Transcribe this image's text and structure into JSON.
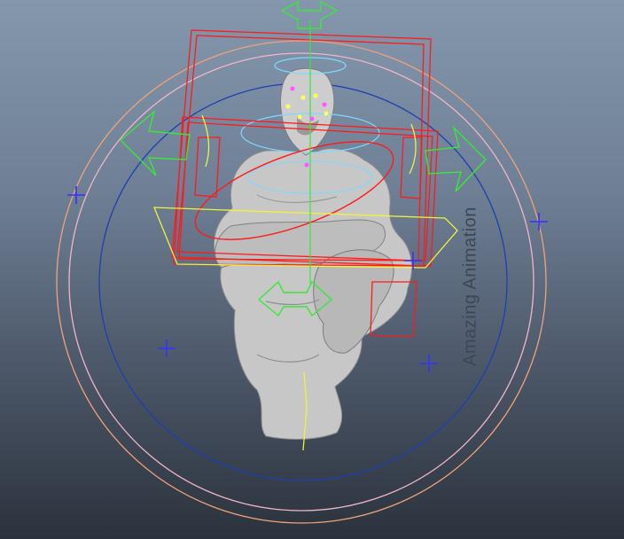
{
  "viewport": {
    "background_top": "#8497ad",
    "background_bottom": "#2b323c",
    "watermark": "Amazing Animation"
  },
  "colors": {
    "mesh": "#c9c9c9",
    "mesh_shadow": "#6e6e6e",
    "selection_box": "#ff1a1a",
    "arrow_control": "#3be63b",
    "pivot_control": "#f2f23a",
    "head_control": "#7ed8ff",
    "outer_ring": "#f0a27a",
    "middle_ring": "#f3b5c8",
    "inner_ring": "#1d3fb0",
    "locator": "#3333ff"
  },
  "icons": {
    "locator": "locator-cross-icon",
    "arrow": "arrow-control-icon"
  }
}
